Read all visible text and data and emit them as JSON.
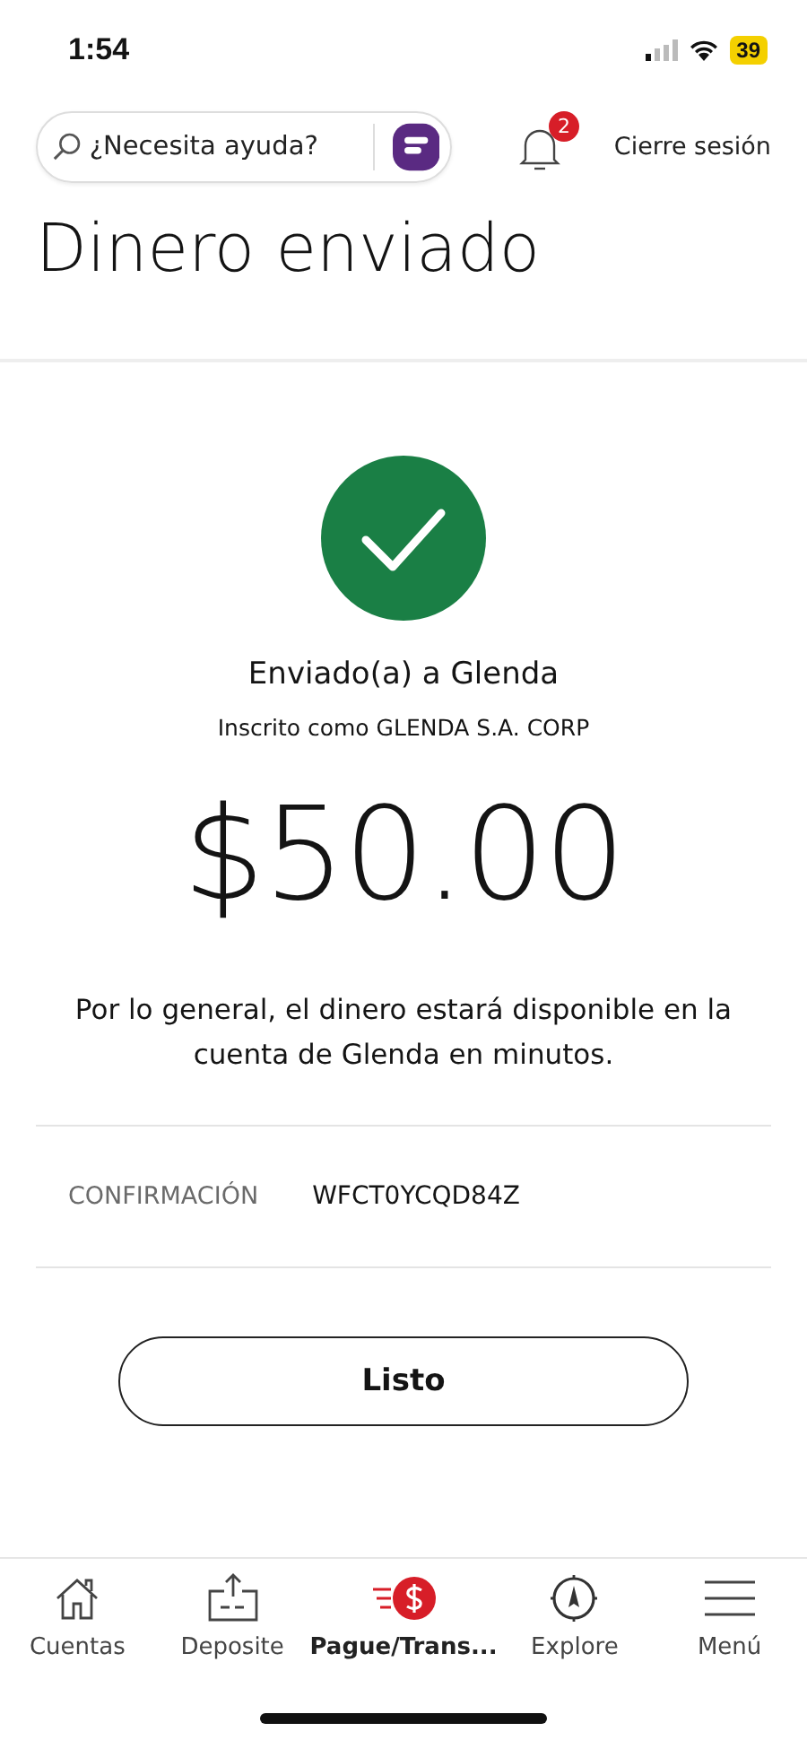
{
  "status_bar": {
    "time": "1:54",
    "battery": "39"
  },
  "header": {
    "search": {
      "placeholder": "¿Necesita ayuda?"
    },
    "notifications_badge": "2",
    "logout": "Cierre sesión"
  },
  "title": "Dinero enviado",
  "recipient": "Enviado(a) a Glenda",
  "registered_as": "Inscrito como GLENDA S.A. CORP",
  "amount": "$50.00",
  "note": "Por lo general, el dinero estará disponible en la cuenta de Glenda en minutos.",
  "confirmation": {
    "label": "CONFIRMACIÓN",
    "value": "WFCT0YCQD84Z"
  },
  "done_button": "Listo",
  "nav": [
    {
      "kind": "home",
      "label": "Cuentas",
      "selected": false
    },
    {
      "kind": "deposit",
      "label": "Deposite",
      "selected": false
    },
    {
      "kind": "pay",
      "label": "Pague/Trans...",
      "selected": true
    },
    {
      "kind": "explore",
      "label": "Explore",
      "selected": false
    },
    {
      "kind": "menu",
      "label": "Menú",
      "selected": false
    }
  ]
}
